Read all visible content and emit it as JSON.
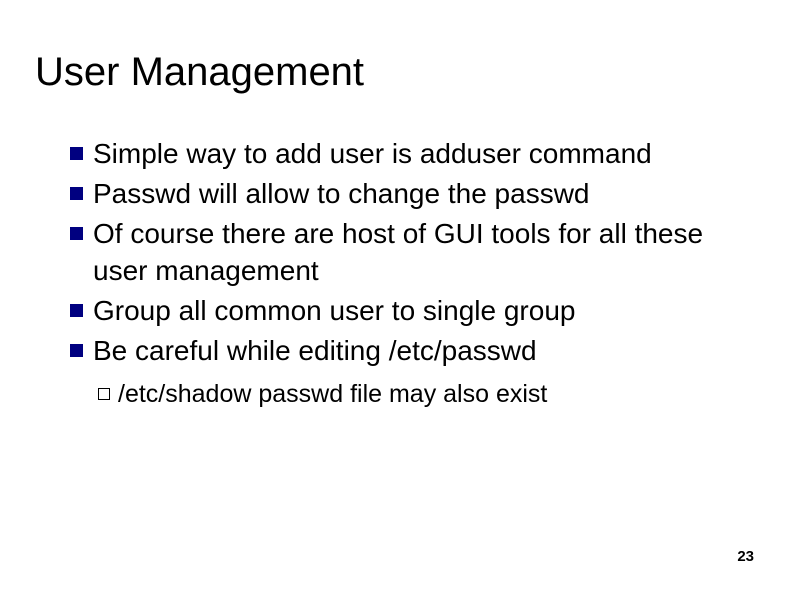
{
  "slide": {
    "title": "User Management",
    "bullets": [
      {
        "text": "Simple way to add user is adduser command"
      },
      {
        "text": "Passwd will allow to change the passwd"
      },
      {
        "text": "Of course there are host of GUI tools for all these user management"
      },
      {
        "text": "Group all common user to single group"
      },
      {
        "text": "Be careful while editing /etc/passwd"
      }
    ],
    "subitem": "/etc/shadow passwd file may also exist",
    "page_number": "23"
  }
}
